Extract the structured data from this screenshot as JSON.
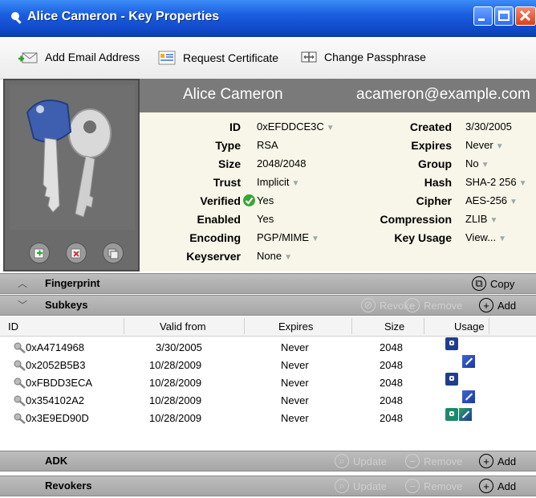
{
  "window": {
    "title": "Alice Cameron - Key Properties"
  },
  "toolbar": {
    "add_email": "Add Email Address",
    "request_cert": "Request Certificate",
    "change_pass": "Change Passphrase"
  },
  "key": {
    "name": "Alice Cameron",
    "email": "acameron@example.com"
  },
  "props_left": [
    {
      "label": "ID",
      "value": "0xEFDDCE3C",
      "dropdown": true
    },
    {
      "label": "Type",
      "value": "RSA",
      "dropdown": false
    },
    {
      "label": "Size",
      "value": "2048/2048",
      "dropdown": false
    },
    {
      "label": "Trust",
      "value": "Implicit",
      "dropdown": true
    },
    {
      "label": "Verified",
      "value": "Yes",
      "dropdown": false
    },
    {
      "label": "Enabled",
      "value": "Yes",
      "dropdown": false
    },
    {
      "label": "Encoding",
      "value": "PGP/MIME",
      "dropdown": true
    },
    {
      "label": "Keyserver",
      "value": "None",
      "dropdown": true
    }
  ],
  "props_right": [
    {
      "label": "Created",
      "value": "3/30/2005",
      "dropdown": false
    },
    {
      "label": "Expires",
      "value": "Never",
      "dropdown": true
    },
    {
      "label": "Group",
      "value": "No",
      "dropdown": true
    },
    {
      "label": "Hash",
      "value": "SHA-2 256",
      "dropdown": true
    },
    {
      "label": "Cipher",
      "value": "AES-256",
      "dropdown": true
    },
    {
      "label": "Compression",
      "value": "ZLIB",
      "dropdown": true
    },
    {
      "label": "Key Usage",
      "value": "View...",
      "dropdown": true
    }
  ],
  "sections": {
    "fingerprint": {
      "title": "Fingerprint",
      "copy": "Copy"
    },
    "subkeys": {
      "title": "Subkeys",
      "revoke": "Revoke",
      "remove": "Remove",
      "add": "Add"
    },
    "adk": {
      "title": "ADK",
      "update": "Update",
      "remove": "Remove",
      "add": "Add"
    },
    "revokers": {
      "title": "Revokers",
      "update": "Update",
      "remove": "Remove",
      "add": "Add"
    }
  },
  "subkeys_table": {
    "columns": [
      "ID",
      "Valid from",
      "Expires",
      "Size",
      "Usage"
    ],
    "rows": [
      {
        "id": "0xA4714968",
        "valid_from": "3/30/2005",
        "expires": "Never",
        "size": "2048",
        "usage": [
          "encrypt-icon"
        ]
      },
      {
        "id": "0x2052B5B3",
        "valid_from": "10/28/2009",
        "expires": "Never",
        "size": "2048",
        "usage": [
          "sign-icon"
        ]
      },
      {
        "id": "0xFBDD3ECA",
        "valid_from": "10/28/2009",
        "expires": "Never",
        "size": "2048",
        "usage": [
          "encrypt-icon"
        ]
      },
      {
        "id": "0x354102A2",
        "valid_from": "10/28/2009",
        "expires": "Never",
        "size": "2048",
        "usage": [
          "sign-icon"
        ]
      },
      {
        "id": "0x3E9ED90D",
        "valid_from": "10/28/2009",
        "expires": "Never",
        "size": "2048",
        "usage": [
          "encrypt-icon",
          "sign-icon"
        ]
      }
    ]
  },
  "colors": {
    "titlebar": "#1a5fe0",
    "header_bg": "#7a7a7a",
    "props_bg": "#f8f6e8",
    "section_bg": "#b3b3b3",
    "verified_green": "#3aa53a"
  }
}
